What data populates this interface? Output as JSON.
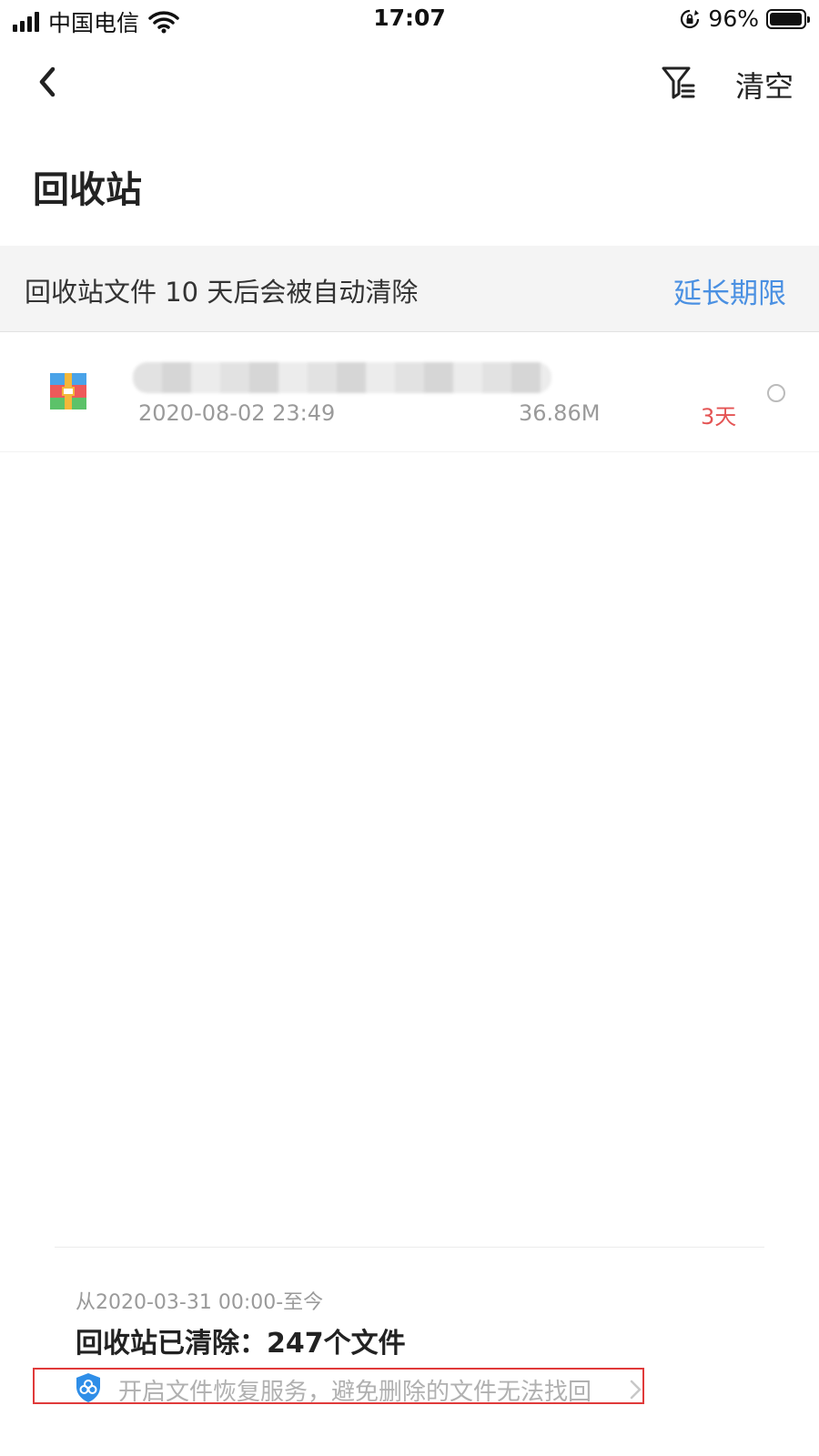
{
  "status_bar": {
    "carrier": "中国电信",
    "time": "17:07",
    "battery_percent": "96%",
    "battery_level": 0.96,
    "icons": [
      "signal-icon",
      "wifi-icon",
      "rotation-lock-icon",
      "battery-icon"
    ]
  },
  "nav": {
    "back_icon": "back-chevron-icon",
    "filter_icon": "filter-icon",
    "clear_label": "清空"
  },
  "page_title": "回收站",
  "notice": {
    "text": "回收站文件 10 天后会被自动清除",
    "extend_label": "延长期限",
    "link_color": "#4a90e2"
  },
  "files": [
    {
      "icon": "zip-archive-icon",
      "name": "",
      "date": "2020-08-02 23:49",
      "size": "36.86M",
      "days_left": "3天",
      "days_color": "#e45454"
    }
  ],
  "summary": {
    "since": "从2020-03-31 00:00-至今",
    "cleared": "回收站已清除：247个文件",
    "recovery_text": "开启文件恢复服务，避免删除的文件无法找回",
    "recovery_icon": "shield-icon",
    "chevron_icon": "chevron-right-icon",
    "highlight_color": "#e03a3a"
  }
}
